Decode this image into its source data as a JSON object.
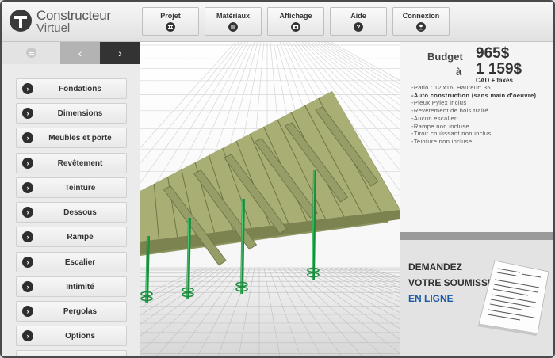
{
  "app": {
    "logo_line1": "Constructeur",
    "logo_line2": "Virtuel"
  },
  "nav": [
    {
      "label": "Projet",
      "icon": "grid-icon"
    },
    {
      "label": "Matériaux",
      "icon": "list-icon"
    },
    {
      "label": "Affichage",
      "icon": "camera-icon"
    },
    {
      "label": "Aide",
      "icon": "question-icon"
    },
    {
      "label": "Connexion",
      "icon": "user-icon"
    }
  ],
  "sidebar": {
    "prev_glyph": "‹",
    "next_glyph": "›",
    "items": [
      {
        "label": "Fondations"
      },
      {
        "label": "Dimensions"
      },
      {
        "label": "Meubles et porte"
      },
      {
        "label": "Revêtement"
      },
      {
        "label": "Teinture"
      },
      {
        "label": "Dessous"
      },
      {
        "label": "Rampe"
      },
      {
        "label": "Escalier"
      },
      {
        "label": "Intimité"
      },
      {
        "label": "Pergolas"
      },
      {
        "label": "Options"
      }
    ]
  },
  "budget": {
    "label": "Budget",
    "min": "965$",
    "to": "à",
    "max": "1 159$",
    "currency": "CAD + taxes"
  },
  "details": [
    {
      "text": "-Patio : 12'x16'  Hauteur: 35",
      "bold": false
    },
    {
      "text": "-Auto construction (sans main d'oeuvre)",
      "bold": true
    },
    {
      "text": "-Pieux Pylex inclus",
      "bold": false
    },
    {
      "text": "-Revêtement de bois traité",
      "bold": false
    },
    {
      "text": "-Aucun escalier",
      "bold": false
    },
    {
      "text": "-Rampe non incluse",
      "bold": false
    },
    {
      "text": "-Tiroir coulissant non inclus",
      "bold": false
    },
    {
      "text": "-Teinture non incluse",
      "bold": false
    }
  ],
  "promo": {
    "line1": "DEMANDEZ",
    "line2": "VOTRE SOUMISSION",
    "line3": "EN LIGNE"
  },
  "colors": {
    "deck_wood": "#a8ae74",
    "pile_green": "#1e8c3e",
    "promo_link": "#1a5aa6"
  }
}
